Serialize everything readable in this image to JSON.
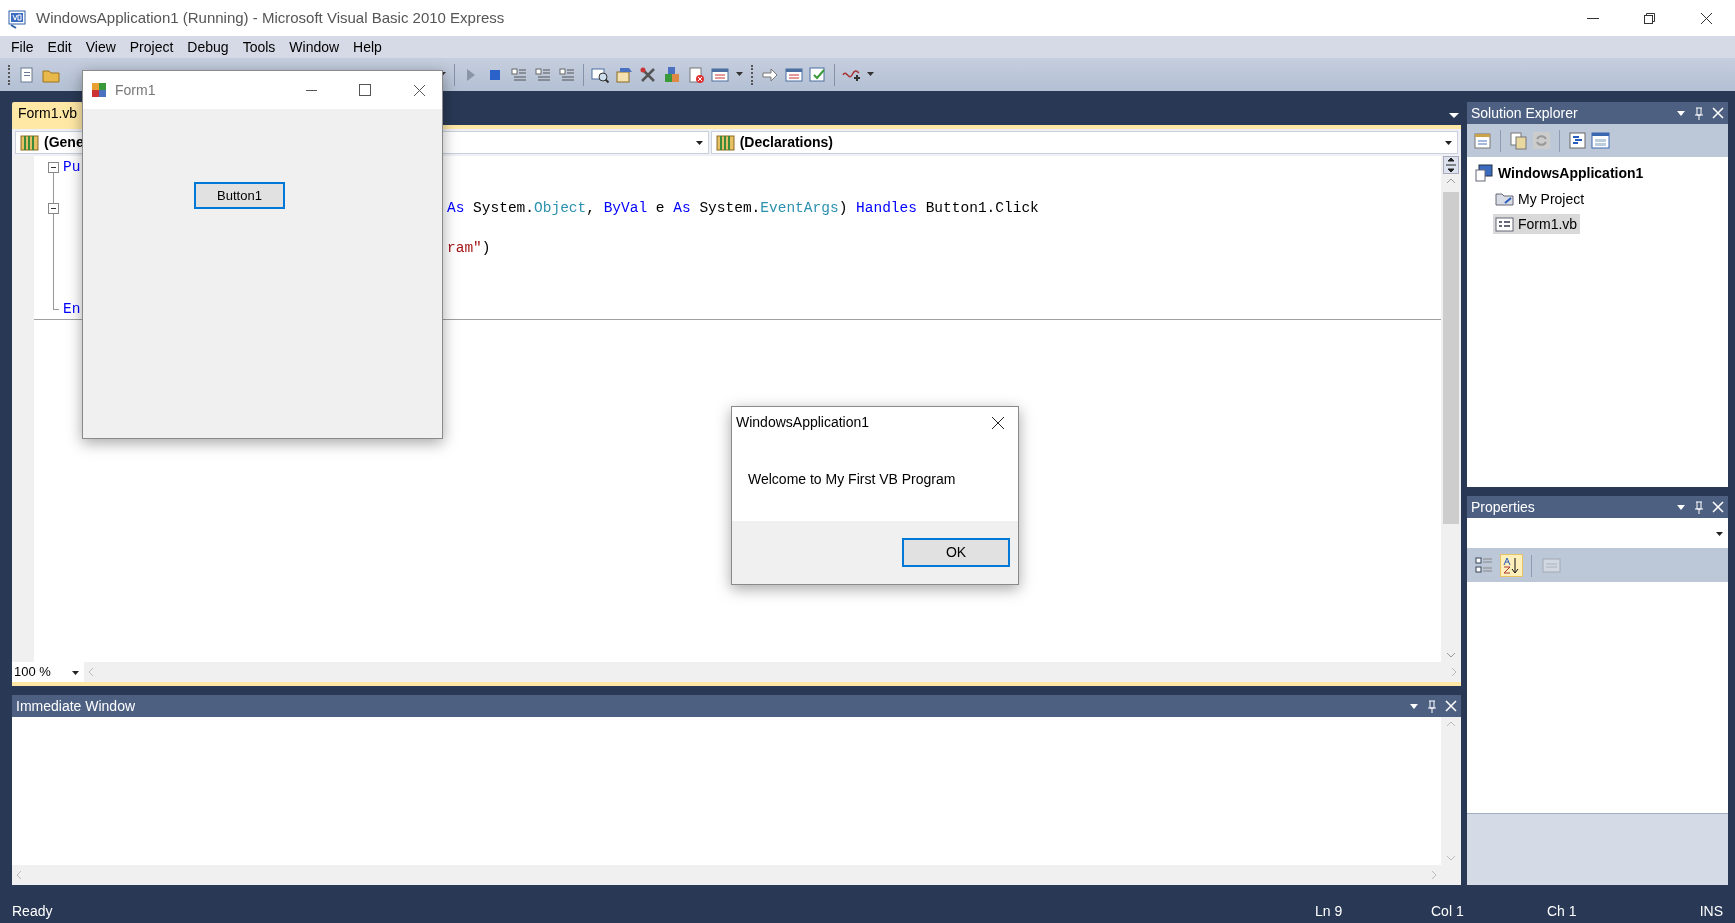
{
  "window": {
    "title": "WindowsApplication1 (Running) - Microsoft Visual Basic 2010 Express"
  },
  "menu": [
    "File",
    "Edit",
    "View",
    "Project",
    "Debug",
    "Tools",
    "Window",
    "Help"
  ],
  "document_tabs": [
    {
      "label": "Form1.vb",
      "selected": true
    }
  ],
  "editor": {
    "type_dropdown": "(Gene",
    "member_dropdown": "(Declarations)",
    "zoom": "100 %",
    "code_lines": [
      {
        "kind": "full",
        "fold": {
          "expanded": true
        },
        "tokens": [
          {
            "text": "Pu",
            "color": "#0000ff"
          }
        ]
      },
      {
        "kind": "blank"
      },
      {
        "kind": "partial",
        "fold": {
          "expanded": true
        },
        "tokens": [
          {
            "text": "As",
            "color": "#0000ff"
          },
          {
            "text": " System."
          },
          {
            "text": "Object",
            "color": "#2b91af"
          },
          {
            "text": ", "
          },
          {
            "text": "ByVal",
            "color": "#0000ff"
          },
          {
            "text": " e "
          },
          {
            "text": "As",
            "color": "#0000ff"
          },
          {
            "text": " System."
          },
          {
            "text": "EventArgs",
            "color": "#2b91af"
          },
          {
            "text": ") "
          },
          {
            "text": "Handles",
            "color": "#0000ff"
          },
          {
            "text": " Button1.Click"
          }
        ]
      },
      {
        "kind": "blank"
      },
      {
        "kind": "partial",
        "tokens": [
          {
            "text": "ram\"",
            "color": "#a31515"
          },
          {
            "text": ")"
          }
        ]
      },
      {
        "kind": "blank"
      },
      {
        "kind": "blank"
      },
      {
        "kind": "full",
        "tokens": [
          {
            "text": "En",
            "color": "#0000ff"
          }
        ]
      }
    ]
  },
  "immediate_window": {
    "title": "Immediate Window"
  },
  "solution_explorer": {
    "title": "Solution Explorer",
    "tree": [
      {
        "label": "WindowsApplication1",
        "kind": "solution",
        "selected": false,
        "children": [
          {
            "label": "My Project",
            "kind": "project-folder",
            "selected": false
          },
          {
            "label": "Form1.vb",
            "kind": "form",
            "selected": true
          }
        ]
      }
    ]
  },
  "properties": {
    "title": "Properties",
    "tools": [
      {
        "kind": "categorized",
        "selected": false,
        "disabled": false
      },
      {
        "kind": "alphabetical",
        "selected": true,
        "disabled": false
      },
      {
        "kind": "pages",
        "selected": false,
        "disabled": true
      }
    ]
  },
  "form_window": {
    "title": "Form1",
    "button": {
      "label": "Button1",
      "focused": true
    }
  },
  "message_box": {
    "title": "WindowsApplication1",
    "message": "Welcome to My First VB Program",
    "button": {
      "label": "OK",
      "default": true
    }
  },
  "status_bar": {
    "left": "Ready",
    "items": [
      "Ln 9",
      "Col 1",
      "Ch 1",
      "INS"
    ]
  }
}
